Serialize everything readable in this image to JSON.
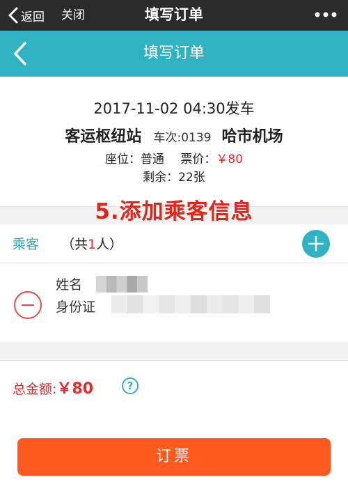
{
  "wechat_bar": {
    "back_label": "返回",
    "close_label": "关闭",
    "title": "填写订单"
  },
  "app_bar": {
    "title": "填写订单",
    "bg_color": "#2fb3c3"
  },
  "trip": {
    "departure": "2017-11-02 04:30发车",
    "from_station": "客运枢纽站",
    "train_no": "车次:0139",
    "to_station": "哈市机场",
    "seat_label": "座位：普通",
    "price_label": "票价：",
    "price_value": "￥80",
    "remaining": "剩余：22张"
  },
  "annotation": {
    "step_text": "5.添加乘客信息"
  },
  "passengers": {
    "label": "乘客",
    "count_prefix": "（共",
    "count_num": "1",
    "count_suffix": "人）",
    "add_icon": "plus-circle-icon",
    "items": [
      {
        "name_label": "姓名",
        "id_label": "身份证"
      }
    ]
  },
  "total": {
    "label": "总金额:",
    "value": "￥80",
    "help_icon": "?"
  },
  "book_button": {
    "label": "订票",
    "color": "#ff5a1f"
  },
  "colors": {
    "accent": "#2fb3c3",
    "price_red": "#e02c2c",
    "annotation_red": "#e1251b"
  }
}
